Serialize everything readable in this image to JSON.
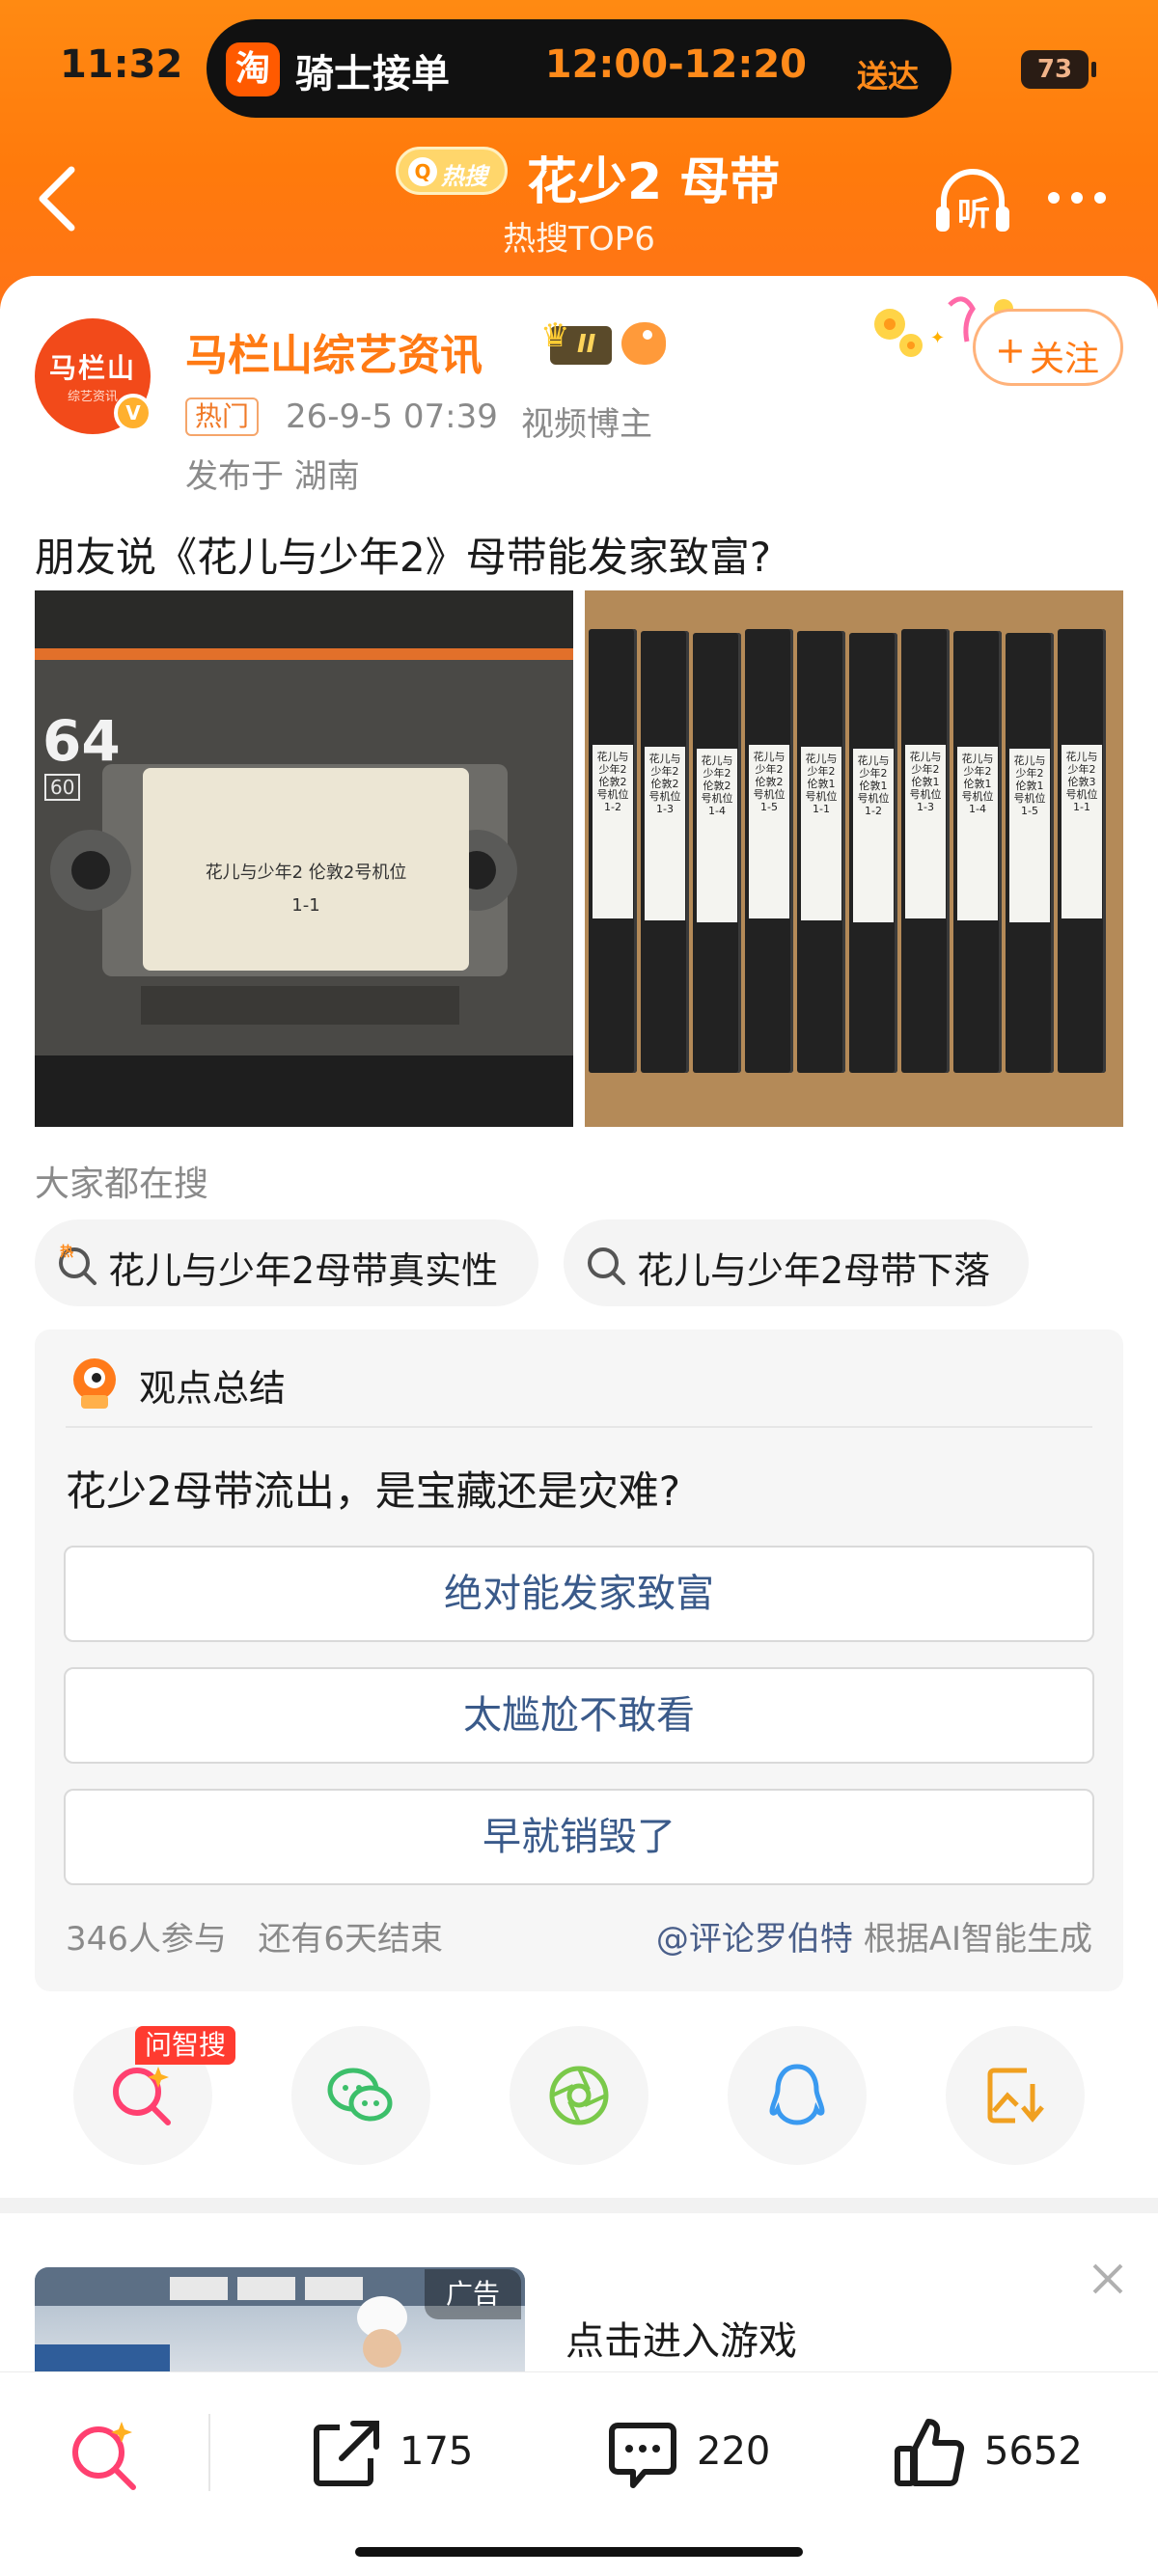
{
  "status_bar": {
    "time": "11:32",
    "island_app_icon": "淘",
    "island_title": "骑士接单",
    "island_time": "12:00-12:20",
    "island_suffix": "送达",
    "battery": "73"
  },
  "nav": {
    "hot_badge": "热搜",
    "title": "花少2 母带",
    "subtitle": "热搜TOP6",
    "listen_label": "听"
  },
  "post": {
    "author": "马栏山综艺资讯",
    "avatar_text": "马栏山",
    "avatar_subtext": "综艺资讯",
    "verify_mark": "V",
    "level": "II",
    "follow_label": "关注",
    "hot_tag": "热门",
    "time": "26-9-5 07:39",
    "role": "视频博主",
    "location": "发布于 湖南",
    "text": "朋友说《花儿与少年2》母带能发家致富?"
  },
  "images": {
    "left_tape": {
      "brand_mark": "64",
      "brand_sub": "60",
      "label_line1": "花儿与少年2  伦敦2号机位",
      "label_line2": "1-1"
    },
    "right_tapes": [
      {
        "text": "花儿与少年2 伦敦2号机位 1-2"
      },
      {
        "text": "花儿与少年2 伦敦2号机位 1-3"
      },
      {
        "text": "花儿与少年2 伦敦2号机位 1-4"
      },
      {
        "text": "花儿与少年2 伦敦2号机位 1-5"
      },
      {
        "text": "花儿与少年2 伦敦1号机位 1-1"
      },
      {
        "text": "花儿与少年2 伦敦1号机位 1-2"
      },
      {
        "text": "花儿与少年2 伦敦1号机位 1-3"
      },
      {
        "text": "花儿与少年2 伦敦1号机位 1-4"
      },
      {
        "text": "花儿与少年2 伦敦1号机位 1-5"
      },
      {
        "text": "花儿与少年2 伦敦3号机位 1-1"
      }
    ]
  },
  "search": {
    "heading": "大家都在搜",
    "chips": [
      "花儿与少年2母带真实性",
      "花儿与少年2母带下落"
    ]
  },
  "opinion": {
    "title": "观点总结",
    "question": "花少2母带流出，是宝藏还是灾难?",
    "options": [
      "绝对能发家致富",
      "太尴尬不敢看",
      "早就销毁了"
    ],
    "participants": "346人参与",
    "remaining": "还有6天结束",
    "credit_at": "@评论罗伯特",
    "credit_rest": " 根据AI智能生成"
  },
  "share": {
    "ask_badge": "问智搜",
    "buttons": [
      "ai-search-icon",
      "wechat-icon",
      "moments-icon",
      "qq-icon",
      "save-image-icon"
    ]
  },
  "ad": {
    "tag": "广告",
    "title": "点击进入游戏"
  },
  "toolbar": {
    "repost_count": "175",
    "comment_count": "220",
    "like_count": "5652"
  },
  "colors": {
    "header_orange": "#ff7a0c",
    "accent_orange": "#ff7a14",
    "link_blue": "#3a5a8a"
  }
}
